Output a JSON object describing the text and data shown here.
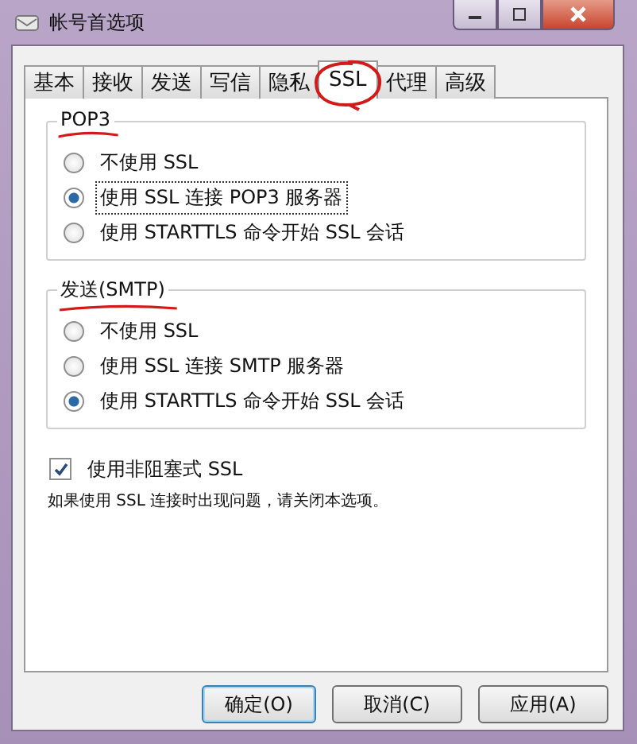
{
  "window": {
    "title": "帐号首选项"
  },
  "tabs": [
    {
      "label": "基本",
      "selected": false
    },
    {
      "label": "接收",
      "selected": false
    },
    {
      "label": "发送",
      "selected": false
    },
    {
      "label": "写信",
      "selected": false
    },
    {
      "label": "隐私",
      "selected": false
    },
    {
      "label": "SSL",
      "selected": true,
      "circled": true
    },
    {
      "label": "代理",
      "selected": false
    },
    {
      "label": "高级",
      "selected": false
    }
  ],
  "groups": [
    {
      "title": "POP3",
      "underlined": true,
      "options": [
        {
          "label": "不使用 SSL",
          "selected": false
        },
        {
          "label": "使用 SSL 连接 POP3 服务器",
          "selected": true
        },
        {
          "label": "使用 STARTTLS 命令开始 SSL 会话",
          "selected": false
        }
      ]
    },
    {
      "title": "发送(SMTP)",
      "underlined": true,
      "options": [
        {
          "label": "不使用 SSL",
          "selected": false
        },
        {
          "label": "使用 SSL 连接 SMTP 服务器",
          "selected": false
        },
        {
          "label": "使用 STARTTLS 命令开始 SSL 会话",
          "selected": true
        }
      ]
    }
  ],
  "nonblocking": {
    "label": "使用非阻塞式 SSL",
    "checked": true
  },
  "note": "如果使用 SSL 连接时出现问题，请关闭本选项。",
  "buttons": [
    {
      "label": "确定(O)",
      "default": true
    },
    {
      "label": "取消(C)",
      "default": false
    },
    {
      "label": "应用(A)",
      "default": false
    }
  ]
}
